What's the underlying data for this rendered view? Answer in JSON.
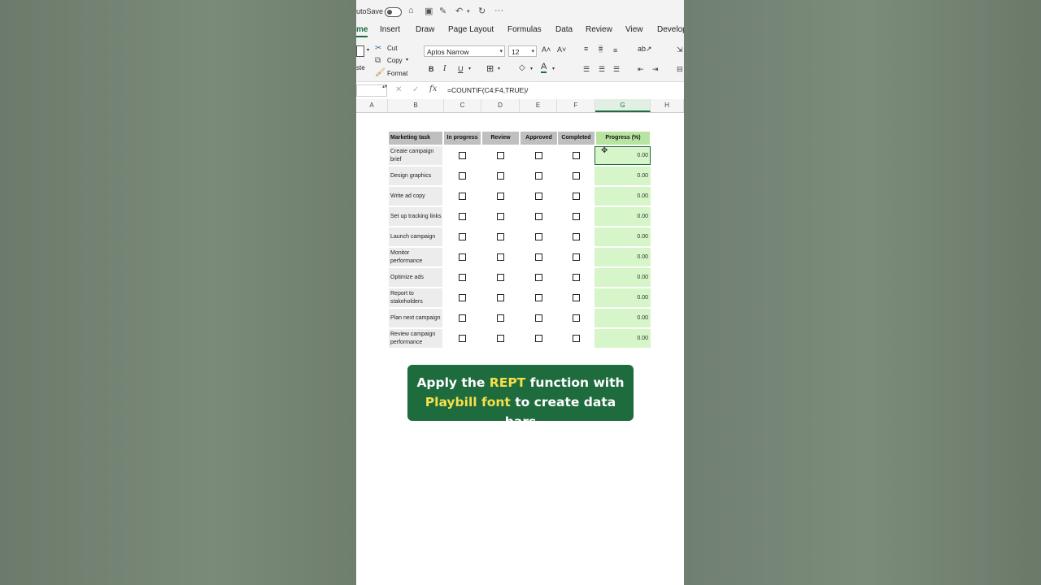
{
  "titlebar": {
    "autosave_label": "utoSave"
  },
  "tabs": [
    {
      "label": "me"
    },
    {
      "label": "Insert"
    },
    {
      "label": "Draw"
    },
    {
      "label": "Page Layout"
    },
    {
      "label": "Formulas"
    },
    {
      "label": "Data"
    },
    {
      "label": "Review"
    },
    {
      "label": "View"
    },
    {
      "label": "Develop"
    }
  ],
  "ribbon": {
    "cut": "Cut",
    "copy": "Copy",
    "format": "Format",
    "paste": "ste",
    "font_name": "Aptos Narrow",
    "font_size": "12",
    "bold": "B",
    "italic": "I",
    "underline": "U"
  },
  "formula_bar": {
    "fx": "fx",
    "formula": "=COUNTIF(C4:F4,TRUE)/"
  },
  "columns": [
    {
      "label": "A"
    },
    {
      "label": "B"
    },
    {
      "label": "C"
    },
    {
      "label": "D"
    },
    {
      "label": "E"
    },
    {
      "label": "F"
    },
    {
      "label": "G"
    },
    {
      "label": "H"
    }
  ],
  "table": {
    "headers": [
      "Marketing task",
      "In progress",
      "Review",
      "Approved",
      "Completed",
      "Progress (%)"
    ],
    "rows": [
      {
        "task": "Create campaign brief",
        "progress": "0.00"
      },
      {
        "task": "Design graphics",
        "progress": "0.00"
      },
      {
        "task": "Write ad copy",
        "progress": "0.00"
      },
      {
        "task": "Set up tracking links",
        "progress": "0.00"
      },
      {
        "task": "Launch campaign",
        "progress": "0.00"
      },
      {
        "task": "Monitor performance",
        "progress": "0.00"
      },
      {
        "task": "Optimize ads",
        "progress": "0.00"
      },
      {
        "task": "Report to stakeholders",
        "progress": "0.00"
      },
      {
        "task": "Plan next campaign",
        "progress": "0.00"
      },
      {
        "task": "Review campaign performance",
        "progress": "0.00"
      }
    ]
  },
  "banner": {
    "part1": "Apply the ",
    "part2": "REPT",
    "part3": " function with",
    "part4": "Playbill font",
    "part5": " to create data bars"
  },
  "colors": {
    "accent": "#1e6b3d",
    "header_gray": "#bfbfbf",
    "progress_green": "#d6f5c8",
    "highlight_yellow": "#f5e04c"
  }
}
